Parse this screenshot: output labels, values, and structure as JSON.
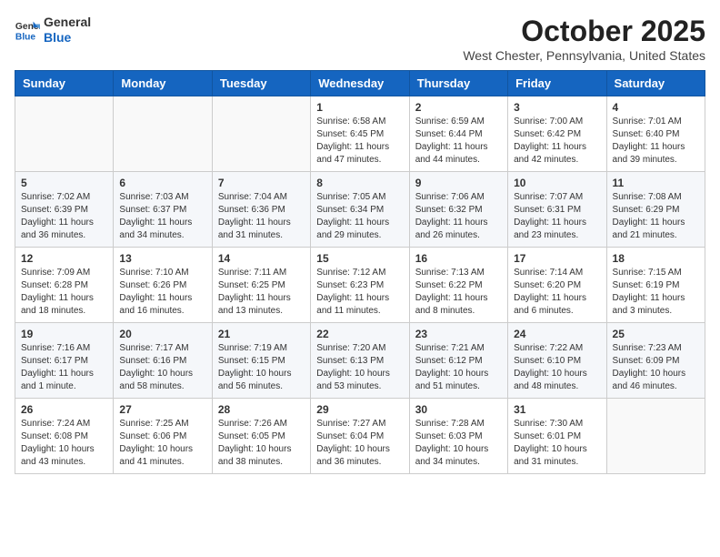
{
  "logo": {
    "line1": "General",
    "line2": "Blue"
  },
  "title": "October 2025",
  "subtitle": "West Chester, Pennsylvania, United States",
  "days_of_week": [
    "Sunday",
    "Monday",
    "Tuesday",
    "Wednesday",
    "Thursday",
    "Friday",
    "Saturday"
  ],
  "weeks": [
    [
      {
        "day": "",
        "info": ""
      },
      {
        "day": "",
        "info": ""
      },
      {
        "day": "",
        "info": ""
      },
      {
        "day": "1",
        "info": "Sunrise: 6:58 AM\nSunset: 6:45 PM\nDaylight: 11 hours and 47 minutes."
      },
      {
        "day": "2",
        "info": "Sunrise: 6:59 AM\nSunset: 6:44 PM\nDaylight: 11 hours and 44 minutes."
      },
      {
        "day": "3",
        "info": "Sunrise: 7:00 AM\nSunset: 6:42 PM\nDaylight: 11 hours and 42 minutes."
      },
      {
        "day": "4",
        "info": "Sunrise: 7:01 AM\nSunset: 6:40 PM\nDaylight: 11 hours and 39 minutes."
      }
    ],
    [
      {
        "day": "5",
        "info": "Sunrise: 7:02 AM\nSunset: 6:39 PM\nDaylight: 11 hours and 36 minutes."
      },
      {
        "day": "6",
        "info": "Sunrise: 7:03 AM\nSunset: 6:37 PM\nDaylight: 11 hours and 34 minutes."
      },
      {
        "day": "7",
        "info": "Sunrise: 7:04 AM\nSunset: 6:36 PM\nDaylight: 11 hours and 31 minutes."
      },
      {
        "day": "8",
        "info": "Sunrise: 7:05 AM\nSunset: 6:34 PM\nDaylight: 11 hours and 29 minutes."
      },
      {
        "day": "9",
        "info": "Sunrise: 7:06 AM\nSunset: 6:32 PM\nDaylight: 11 hours and 26 minutes."
      },
      {
        "day": "10",
        "info": "Sunrise: 7:07 AM\nSunset: 6:31 PM\nDaylight: 11 hours and 23 minutes."
      },
      {
        "day": "11",
        "info": "Sunrise: 7:08 AM\nSunset: 6:29 PM\nDaylight: 11 hours and 21 minutes."
      }
    ],
    [
      {
        "day": "12",
        "info": "Sunrise: 7:09 AM\nSunset: 6:28 PM\nDaylight: 11 hours and 18 minutes."
      },
      {
        "day": "13",
        "info": "Sunrise: 7:10 AM\nSunset: 6:26 PM\nDaylight: 11 hours and 16 minutes."
      },
      {
        "day": "14",
        "info": "Sunrise: 7:11 AM\nSunset: 6:25 PM\nDaylight: 11 hours and 13 minutes."
      },
      {
        "day": "15",
        "info": "Sunrise: 7:12 AM\nSunset: 6:23 PM\nDaylight: 11 hours and 11 minutes."
      },
      {
        "day": "16",
        "info": "Sunrise: 7:13 AM\nSunset: 6:22 PM\nDaylight: 11 hours and 8 minutes."
      },
      {
        "day": "17",
        "info": "Sunrise: 7:14 AM\nSunset: 6:20 PM\nDaylight: 11 hours and 6 minutes."
      },
      {
        "day": "18",
        "info": "Sunrise: 7:15 AM\nSunset: 6:19 PM\nDaylight: 11 hours and 3 minutes."
      }
    ],
    [
      {
        "day": "19",
        "info": "Sunrise: 7:16 AM\nSunset: 6:17 PM\nDaylight: 11 hours and 1 minute."
      },
      {
        "day": "20",
        "info": "Sunrise: 7:17 AM\nSunset: 6:16 PM\nDaylight: 10 hours and 58 minutes."
      },
      {
        "day": "21",
        "info": "Sunrise: 7:19 AM\nSunset: 6:15 PM\nDaylight: 10 hours and 56 minutes."
      },
      {
        "day": "22",
        "info": "Sunrise: 7:20 AM\nSunset: 6:13 PM\nDaylight: 10 hours and 53 minutes."
      },
      {
        "day": "23",
        "info": "Sunrise: 7:21 AM\nSunset: 6:12 PM\nDaylight: 10 hours and 51 minutes."
      },
      {
        "day": "24",
        "info": "Sunrise: 7:22 AM\nSunset: 6:10 PM\nDaylight: 10 hours and 48 minutes."
      },
      {
        "day": "25",
        "info": "Sunrise: 7:23 AM\nSunset: 6:09 PM\nDaylight: 10 hours and 46 minutes."
      }
    ],
    [
      {
        "day": "26",
        "info": "Sunrise: 7:24 AM\nSunset: 6:08 PM\nDaylight: 10 hours and 43 minutes."
      },
      {
        "day": "27",
        "info": "Sunrise: 7:25 AM\nSunset: 6:06 PM\nDaylight: 10 hours and 41 minutes."
      },
      {
        "day": "28",
        "info": "Sunrise: 7:26 AM\nSunset: 6:05 PM\nDaylight: 10 hours and 38 minutes."
      },
      {
        "day": "29",
        "info": "Sunrise: 7:27 AM\nSunset: 6:04 PM\nDaylight: 10 hours and 36 minutes."
      },
      {
        "day": "30",
        "info": "Sunrise: 7:28 AM\nSunset: 6:03 PM\nDaylight: 10 hours and 34 minutes."
      },
      {
        "day": "31",
        "info": "Sunrise: 7:30 AM\nSunset: 6:01 PM\nDaylight: 10 hours and 31 minutes."
      },
      {
        "day": "",
        "info": ""
      }
    ]
  ]
}
